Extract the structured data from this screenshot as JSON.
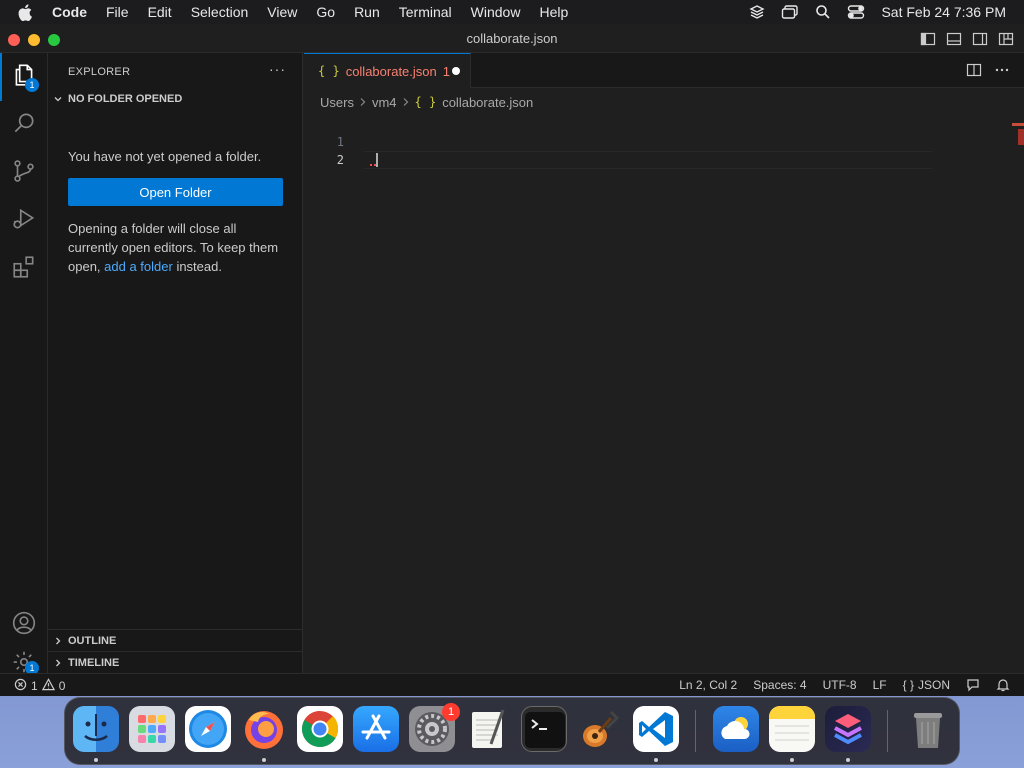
{
  "menubar": {
    "app_name": "Code",
    "items": [
      "File",
      "Edit",
      "Selection",
      "View",
      "Go",
      "Run",
      "Terminal",
      "Window",
      "Help"
    ],
    "clock": "Sat Feb 24  7:36 PM",
    "icons": [
      "apple-logo-icon",
      "layers-icon",
      "screen-mirroring-icon",
      "spotlight-search-icon",
      "control-center-icon"
    ]
  },
  "window": {
    "title": "collaborate.json",
    "layout_icons": [
      "toggle-primary-sidebar-icon",
      "toggle-panel-icon",
      "toggle-secondary-sidebar-icon",
      "customize-layout-icon"
    ]
  },
  "activitybar": {
    "explorer_badge": "1",
    "manage_badge": "1",
    "icons": [
      "files-icon",
      "search-icon",
      "source-control-icon",
      "run-debug-icon",
      "extensions-icon",
      "accounts-icon",
      "manage-gear-icon"
    ]
  },
  "sidebar": {
    "header": "EXPLORER",
    "more": "···",
    "section_title": "NO FOLDER OPENED",
    "message": "You have not yet opened a folder.",
    "open_folder_button": "Open Folder",
    "info_prefix": "Opening a folder will close all currently open editors. To keep them open, ",
    "info_link": "add a folder",
    "info_suffix": " instead.",
    "outline": "OUTLINE",
    "timeline": "TIMELINE"
  },
  "editor": {
    "tab": {
      "icon_text": "{ }",
      "label": "collaborate.json",
      "problem_count": "1"
    },
    "breadcrumb": {
      "parts": [
        "Users",
        "vm4"
      ],
      "file_icon_text": "{ }",
      "file": "collaborate.json"
    },
    "line_numbers": [
      "1",
      "2"
    ],
    "lines": [
      "",
      ""
    ]
  },
  "statusbar": {
    "errors": "1",
    "warnings": "0",
    "position": "Ln 2, Col 2",
    "spaces": "Spaces: 4",
    "encoding": "UTF-8",
    "eol": "LF",
    "language_icon_text": "{ }",
    "language": "JSON"
  },
  "dock": {
    "apps": [
      "Finder",
      "Launchpad",
      "Safari",
      "Firefox",
      "Chrome",
      "App Store",
      "System Settings",
      "TextEdit",
      "Terminal",
      "GarageBand",
      "Visual Studio Code",
      "Weather",
      "Notes",
      "Shortcuts",
      "Trash"
    ],
    "system_settings_badge": "1"
  },
  "colors": {
    "accent": "#0078d4",
    "link": "#4daafc",
    "error": "#f14c4c",
    "modified_tab_text": "#f88070",
    "json_icon": "#cbcb41"
  }
}
